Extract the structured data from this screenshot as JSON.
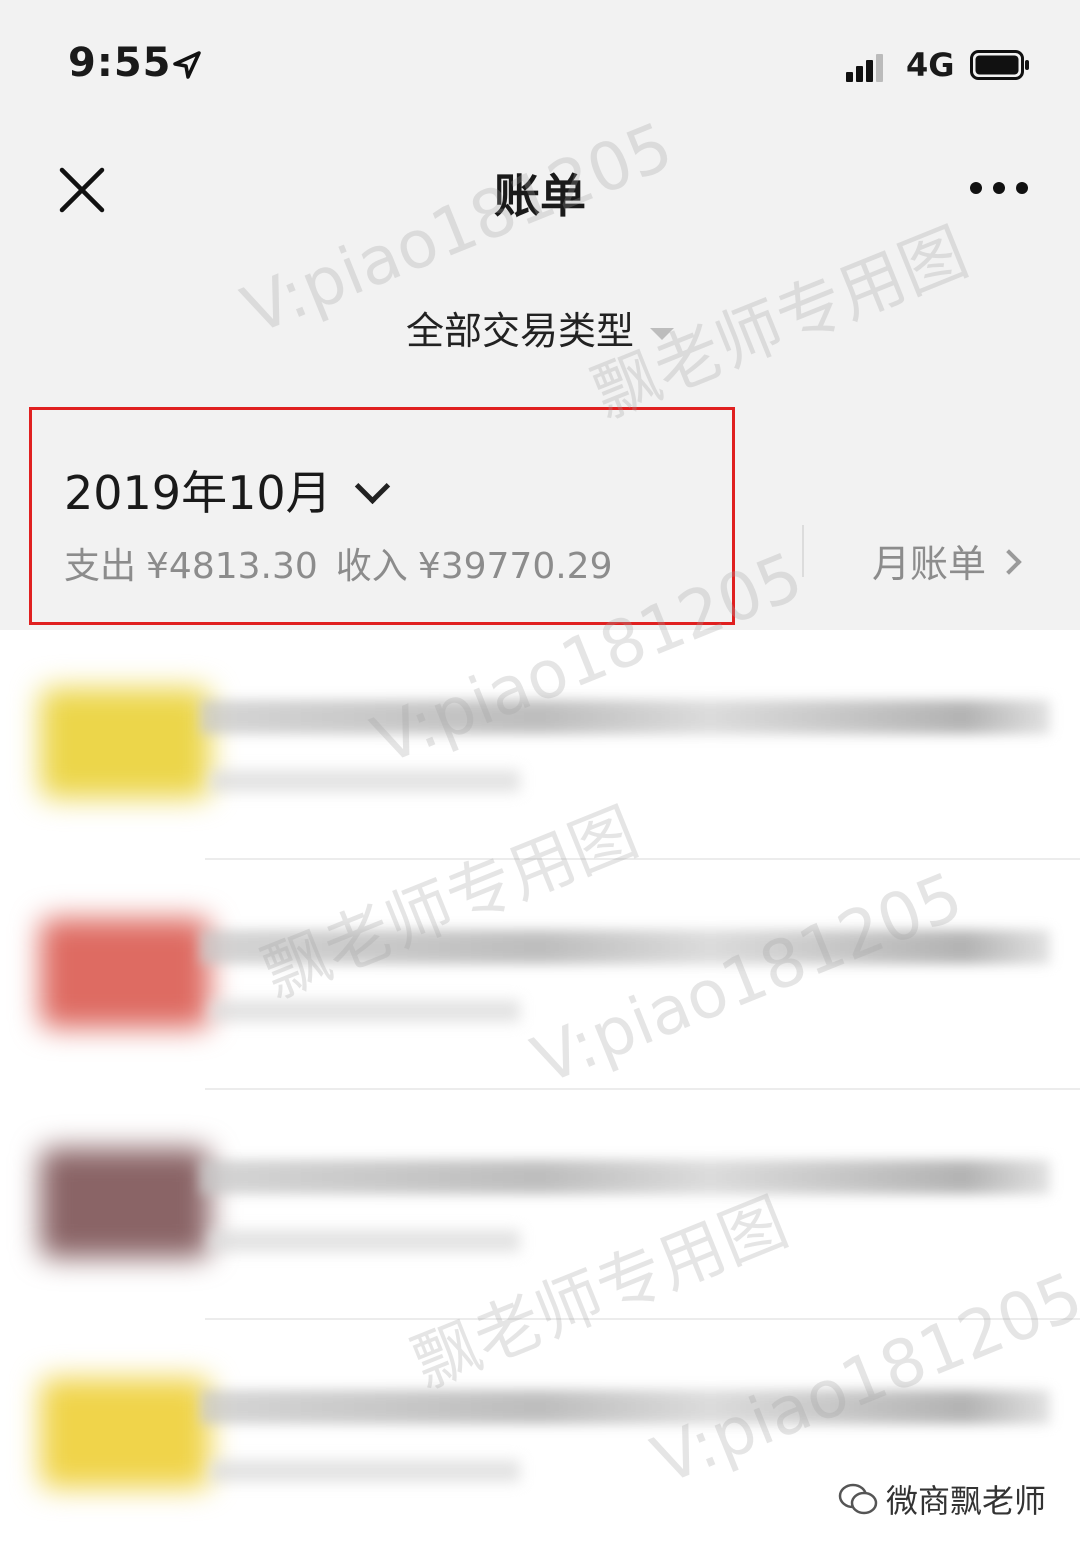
{
  "status_bar": {
    "time": "9:55",
    "network": "4G"
  },
  "nav": {
    "title": "账单"
  },
  "filter": {
    "label": "全部交易类型"
  },
  "month_section": {
    "month": "2019年10月",
    "expense_label": "支出",
    "expense_amount": "¥4813.30",
    "income_label": "收入",
    "income_amount": "¥39770.29",
    "monthly_bill_label": "月账单"
  },
  "transactions": [
    {
      "icon_color": "#ecd64a"
    },
    {
      "icon_color": "#de6b62"
    },
    {
      "icon_color": "#8a6466"
    },
    {
      "icon_color": "#f0d44a"
    }
  ],
  "watermarks": [
    "V:piao181205",
    "飘老师专用图"
  ],
  "brand": {
    "label": "微商飘老师"
  },
  "colors": {
    "highlight": "#e02020",
    "background": "#f2f2f2",
    "muted_text": "#8c8c8c"
  }
}
